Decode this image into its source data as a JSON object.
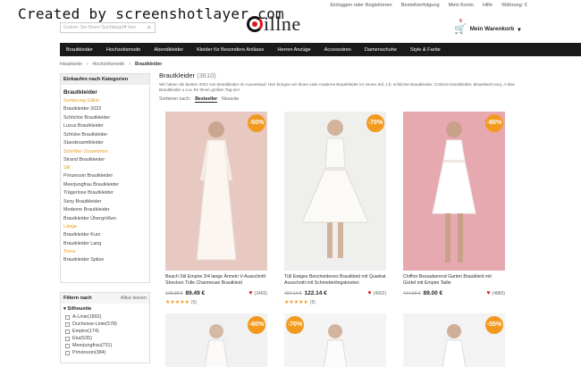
{
  "watermark": "Created by screenshotlayer.com",
  "top_links": [
    "Einloggen oder Registrieren",
    "Bestellverfolgung",
    "Mein Konto",
    "Hilfe",
    "Währung: €"
  ],
  "logo_text": "illne",
  "search": {
    "placeholder": "Geben Sie Ihren Suchbegriff hier"
  },
  "cart": {
    "label": "Mein Warenkorb",
    "count": "0"
  },
  "nav": [
    "Brautkleider",
    "Hochzeitsmode",
    "Abendkleider",
    "Kleider für Besondere Anlässe",
    "Herren Anzüge",
    "Accessoires",
    "Damenschuhe",
    "Style & Farbe"
  ],
  "breadcrumb": [
    "Hauptseite",
    "Hochzeitsmode",
    "Brautkleider"
  ],
  "sidebar": {
    "header": "Einkaufen nach Kategorien",
    "title": "Brautkleider",
    "groups": [
      {
        "label": "Sortierung Gillne",
        "items": [
          "Brautkleider 2022",
          "Schlichte Brautkleider",
          "Luxus Brautkleider",
          "Schicke Brautkleider",
          "Standesamtkleider"
        ]
      },
      {
        "label": "Schriften Zusammen",
        "items": [
          "Strand Brautkleider"
        ]
      },
      {
        "label": "Stil",
        "items": [
          "Prinzessin Brautkleider",
          "Meerjungfrau Brautkleider",
          "Trägerlose Brautkleider",
          "Sexy Brautkleider",
          "Moderne Brautkleider",
          "Brautkleider Übergrößen"
        ]
      },
      {
        "label": "Länge",
        "items": [
          "Brautkleider Kurz",
          "Brautkleider Lang"
        ]
      },
      {
        "label": "Trens",
        "items": [
          "Brautkleider Spitze"
        ]
      }
    ]
  },
  "filters": {
    "header": "Filtern nach",
    "reset": "Alles leeren",
    "section": "Silhouette",
    "options": [
      "A-Linie(1892)",
      "Duchesse-Linie(578)",
      "Empire(174)",
      "Etui(535)",
      "Meerjungfrau(731)",
      "Prinzessin(384)"
    ]
  },
  "main": {
    "title": "Brautkleider",
    "count": "(3610)",
    "description": "Wir haben die besten 2022 von Brautkleider im Ausverkauf. Hier bringen wir Ihnen viele moderne Brautkleider im neuen Stil, z.b. schlichte Brautkleider, Colorne brautkleider, Brautkleid Ivory, A-linie Brautkleider u.s.w. für Ihnen großen Tag ein!",
    "sort_label": "Sortieren nach:",
    "sort_options": [
      "Bestseller",
      "Neueste"
    ]
  },
  "products": [
    {
      "badge": "-50%",
      "name": "Beach Stil Empire 3/4 lange Ärmeln V-Ausschnitt Strecken Tülle Charmeuse Brautkleid",
      "old_price": "178.99 €",
      "price": "89.49 €",
      "likes": "(3465)",
      "reviews": "(5)",
      "bg": "#e8c9c2"
    },
    {
      "badge": "-70%",
      "name": "Tüll Ewiges Bescheidenes Brautkleid mit Quadrat Ausschnitt mit Schmetterlingsknoten",
      "old_price": "407.14 €",
      "price": "122.14 €",
      "likes": "(4002)",
      "reviews": "(5)",
      "bg": "#efefee"
    },
    {
      "badge": "-80%",
      "name": "Chiffon Bezauberend Garten Brautkleid mit Gürtel mit Empire Taille",
      "old_price": "444.99 €",
      "price": "89.00 €",
      "likes": "(4883)",
      "reviews": "",
      "bg": "#e6a9b0"
    },
    {
      "badge": "-60%",
      "bg": "#f1f1f1"
    },
    {
      "badge": "-70%",
      "bg": "#f4f4f4"
    },
    {
      "badge": "-55%",
      "bg": "#f3f3f3"
    }
  ]
}
